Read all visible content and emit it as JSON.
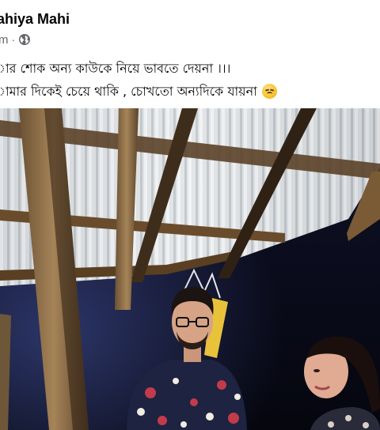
{
  "post": {
    "author_name": "ahiya Mahi",
    "timestamp": "m",
    "separator": "·",
    "audience_icon": "globe-icon",
    "text_lines": [
      "ার শোক অন্য কাউকে নিয়ে ভাবতে দেয়না ।।।",
      "ামার দিকেই চেয়ে থাকি , চোখতো অন্যদিকে যায়না"
    ],
    "emoji": "disappointed-face-emoji"
  },
  "photo": {
    "subject": "post-photo"
  },
  "colors": {
    "text_primary": "#050505",
    "text_secondary": "#65676b",
    "background": "#ffffff"
  }
}
